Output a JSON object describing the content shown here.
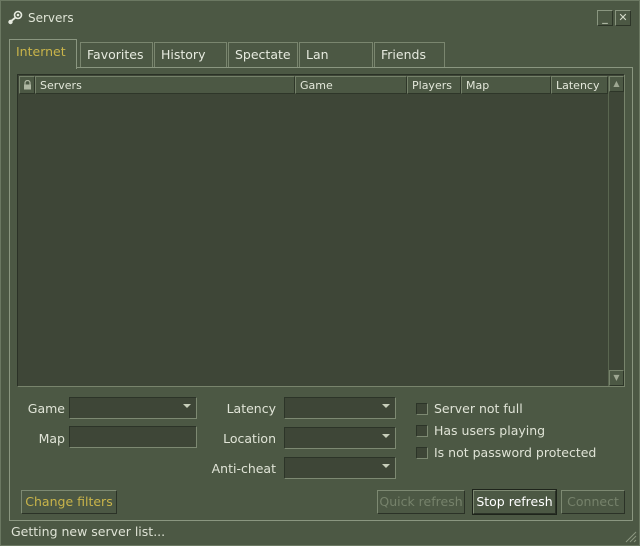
{
  "window": {
    "title": "Servers",
    "minimize_label": "_",
    "close_label": "✕"
  },
  "tabs": [
    {
      "label": "Internet",
      "active": true
    },
    {
      "label": "Favorites",
      "active": false
    },
    {
      "label": "History",
      "active": false
    },
    {
      "label": "Spectate",
      "active": false
    },
    {
      "label": "Lan",
      "active": false
    },
    {
      "label": "Friends",
      "active": false
    }
  ],
  "server_list": {
    "columns": [
      "Servers",
      "Game",
      "Players",
      "Map",
      "Latency"
    ],
    "rows": []
  },
  "filters": {
    "game_label": "Game",
    "map_label": "Map",
    "latency_label": "Latency",
    "location_label": "Location",
    "anticheat_label": "Anti-cheat",
    "checkboxes": [
      {
        "label": "Server not full",
        "checked": false
      },
      {
        "label": "Has users playing",
        "checked": false
      },
      {
        "label": "Is not password protected",
        "checked": false
      }
    ]
  },
  "buttons": {
    "change_filters": "Change filters",
    "quick_refresh": "Quick refresh",
    "stop_refresh": "Stop refresh",
    "connect": "Connect"
  },
  "status": {
    "text": "Getting new server list..."
  },
  "icons": {
    "app": "steam-logo-icon",
    "lock": "lock-icon",
    "resize": "resize-grip-icon"
  },
  "colors": {
    "background": "#4c5844",
    "list_background": "#3e4637",
    "accent_yellow": "#c9b44a",
    "disabled_text": "#76826b"
  }
}
